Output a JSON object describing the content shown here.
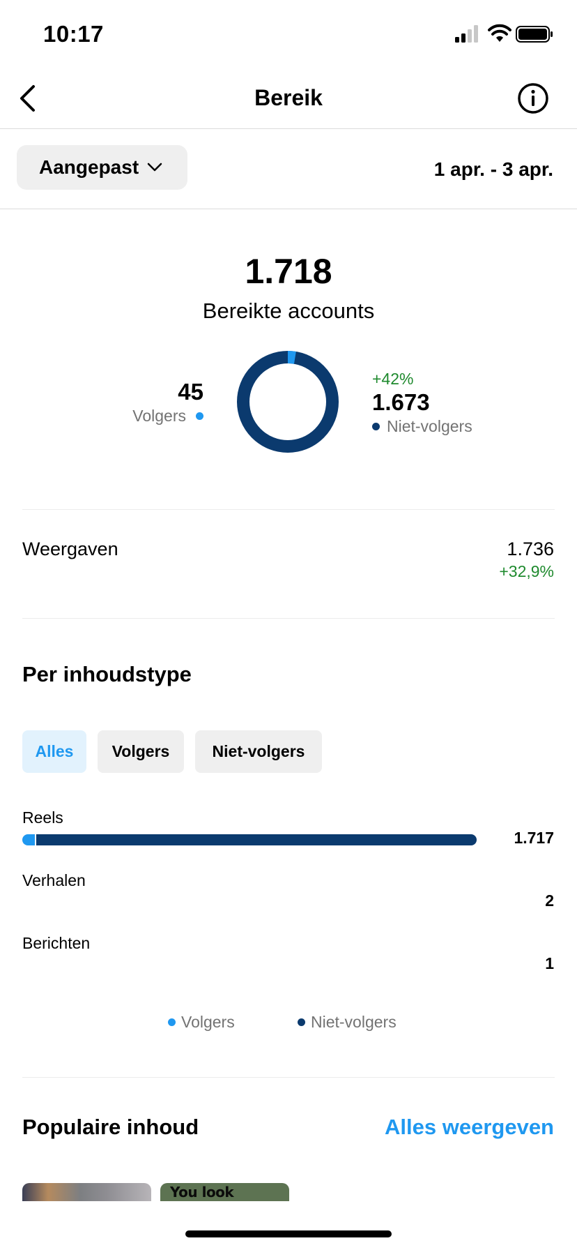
{
  "status_bar": {
    "time": "10:17"
  },
  "nav": {
    "title": "Bereik"
  },
  "filter": {
    "range_label": "Aangepast",
    "date_range": "1 apr. - 3 apr."
  },
  "summary": {
    "accounts_reached": "1.718",
    "accounts_reached_label": "Bereikte accounts",
    "followers_value": "45",
    "followers_label": "Volgers",
    "non_followers_change": "+42%",
    "non_followers_value": "1.673",
    "non_followers_label": "Niet-volgers",
    "followers_share": 0.026
  },
  "views": {
    "label": "Weergaven",
    "value": "1.736",
    "change": "+32,9%"
  },
  "content_type": {
    "title": "Per inhoudstype",
    "chips": [
      "Alles",
      "Volgers",
      "Niet-volgers"
    ],
    "rows": [
      {
        "label": "Reels",
        "value": "1.717",
        "followers_fraction": 0.03,
        "total_fraction": 1.0
      },
      {
        "label": "Verhalen",
        "value": "2"
      },
      {
        "label": "Berichten",
        "value": "1"
      }
    ],
    "legend": [
      "Volgers",
      "Niet-volgers"
    ]
  },
  "popular": {
    "title": "Populaire inhoud",
    "see_all": "Alles weergeven",
    "thumb2_text": "You look lonely..."
  },
  "colors": {
    "followers": "#1f98f0",
    "non_followers": "#0b3a6e",
    "positive": "#1f8a2e",
    "accent": "#1f98f0"
  }
}
